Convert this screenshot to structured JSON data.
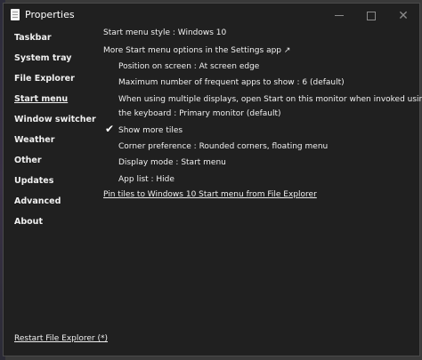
{
  "window": {
    "title": "Properties"
  },
  "sidebar": {
    "items": [
      {
        "label": "Taskbar"
      },
      {
        "label": "System tray"
      },
      {
        "label": "File Explorer"
      },
      {
        "label": "Start menu"
      },
      {
        "label": "Window switcher"
      },
      {
        "label": "Weather"
      },
      {
        "label": "Other"
      },
      {
        "label": "Updates"
      },
      {
        "label": "Advanced"
      },
      {
        "label": "About"
      }
    ],
    "active": "Start menu",
    "restart_label": "Restart File Explorer (*)"
  },
  "content": {
    "start_menu_style": "Start menu style : Windows 10",
    "more_options": "More Start menu options in the Settings app ↗",
    "position": "Position on screen : At screen edge",
    "max_frequent": "Maximum number of frequent apps to show : 6 (default)",
    "multi_display_line1": "When using multiple displays, open Start on this monitor when invoked using",
    "multi_display_line2": "the keyboard : Primary monitor (default)",
    "show_more_tiles": "Show more tiles",
    "show_more_tiles_checked": true,
    "corner_preference": "Corner preference : Rounded corners, floating menu",
    "display_mode": "Display mode : Start menu",
    "app_list": "App list : Hide",
    "pin_tiles": "Pin tiles to Windows 10 Start menu from File Explorer"
  },
  "icons": {
    "app": "properties-window-icon",
    "minimize": "minimize-icon",
    "maximize": "maximize-icon",
    "close": "close-icon",
    "check": "checkmark-icon"
  }
}
